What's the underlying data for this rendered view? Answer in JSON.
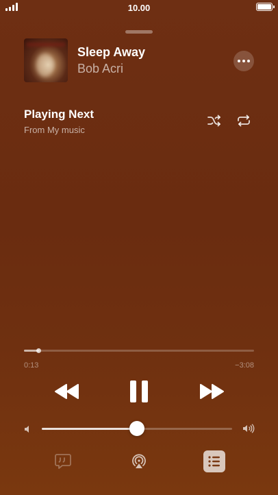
{
  "status_bar": {
    "time": "10.00",
    "signal_bars": 4,
    "battery_level": 1.0
  },
  "now_playing": {
    "title": "Sleep Away",
    "artist": "Bob Acri"
  },
  "playing_next": {
    "title": "Playing Next",
    "subtitle": "From My music"
  },
  "progress": {
    "elapsed": "0:13",
    "remaining": "−3:08",
    "fraction": 0.065
  },
  "volume": {
    "fraction": 0.5
  },
  "icons": {
    "more": "ellipsis-icon",
    "shuffle": "shuffle-icon",
    "repeat": "repeat-icon",
    "rewind": "rewind-icon",
    "pause": "pause-icon",
    "fast_forward": "fast-forward-icon",
    "volume_low": "speaker-low-icon",
    "volume_high": "speaker-high-icon",
    "lyrics": "lyrics-quote-bubble-icon",
    "airplay": "airplay-icon",
    "queue": "list-icon"
  },
  "colors": {
    "background": "#6e2f13",
    "accent": "#ffffff"
  }
}
